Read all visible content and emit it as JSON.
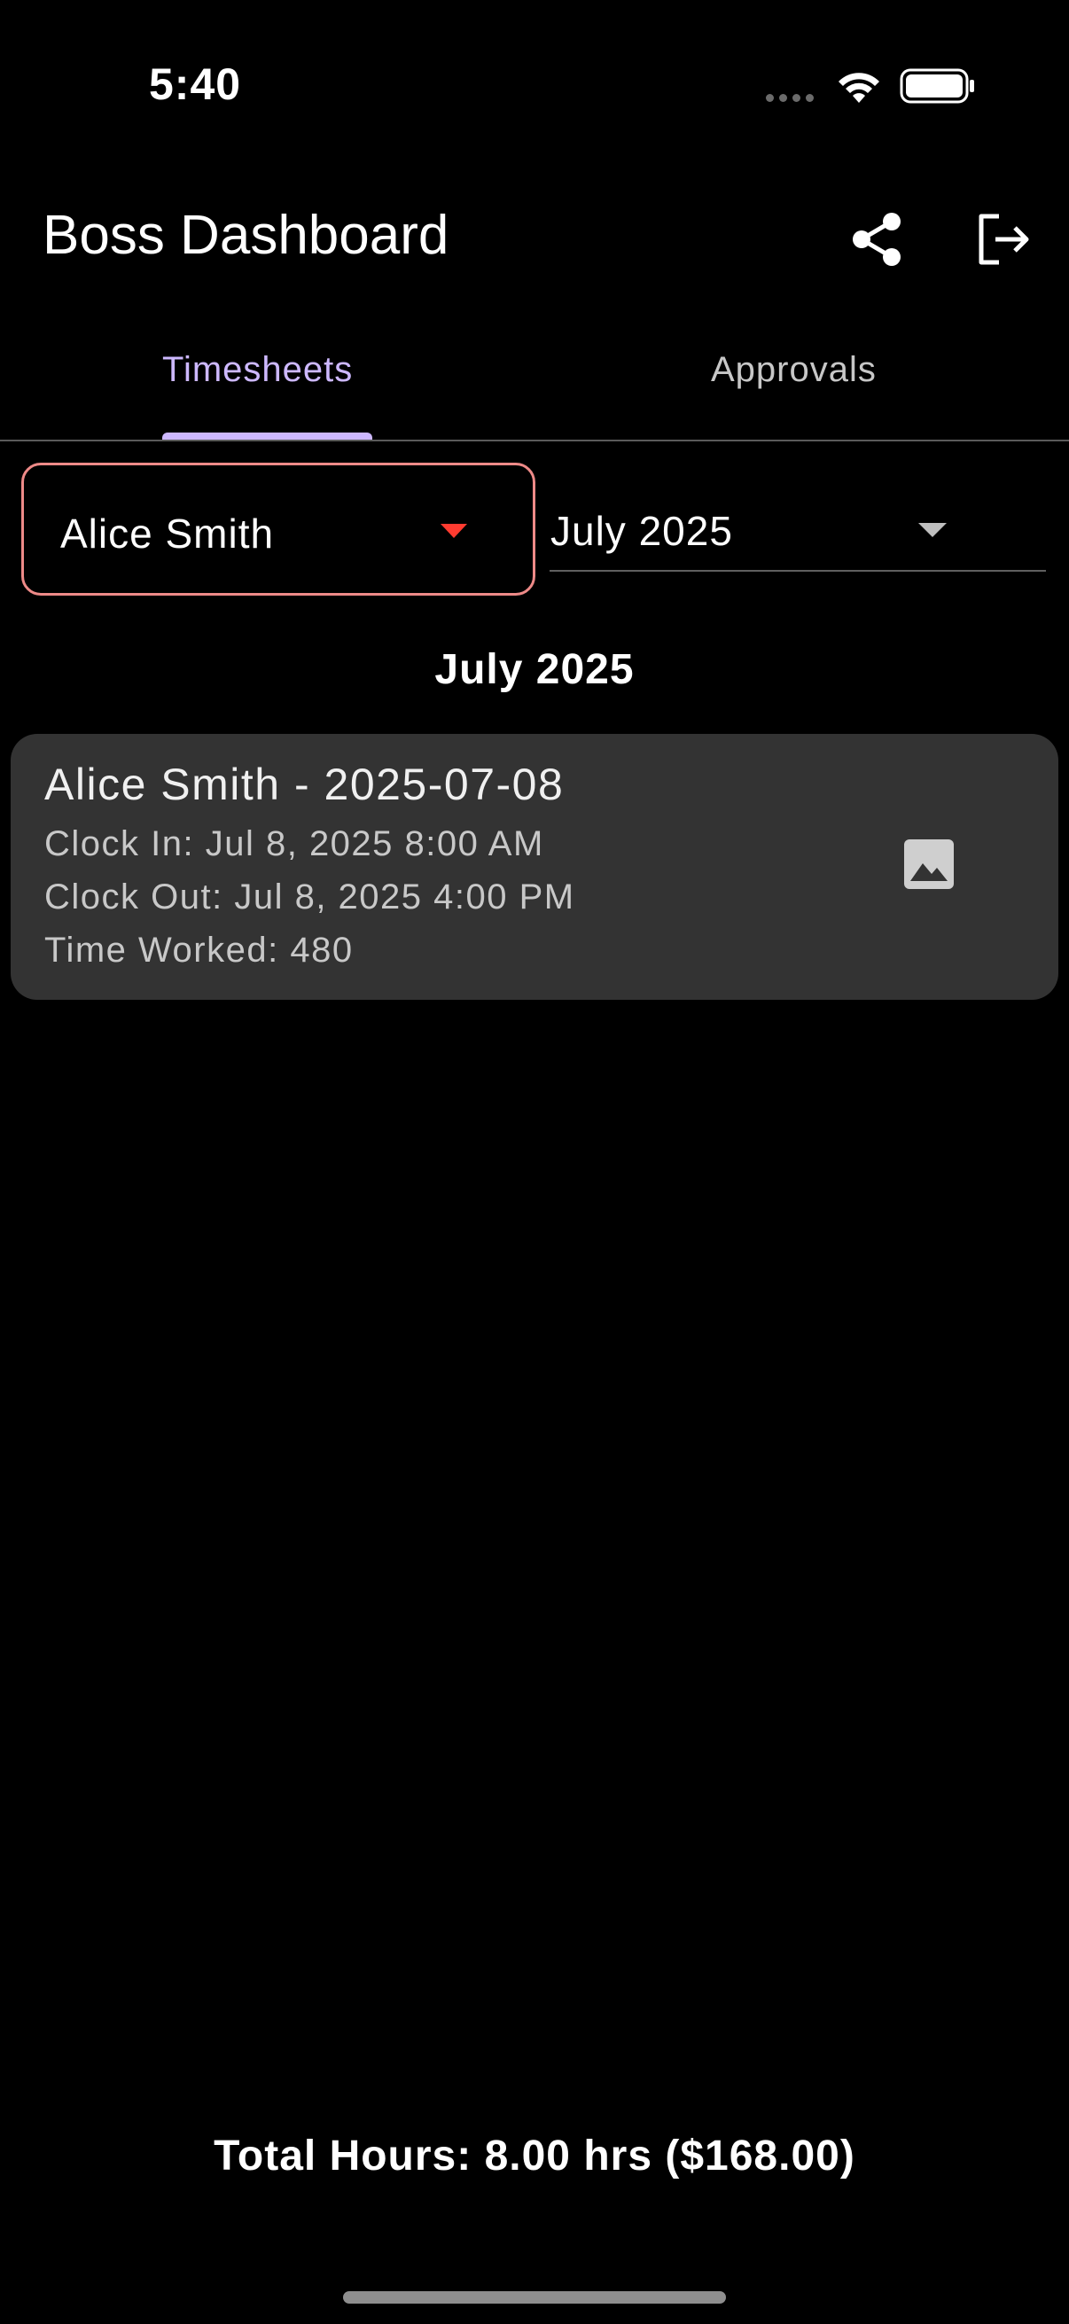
{
  "status_bar": {
    "time": "5:40",
    "icons": [
      "cellular-dots-icon",
      "wifi-icon",
      "battery-icon"
    ]
  },
  "app_bar": {
    "title": "Boss Dashboard",
    "actions": [
      "share-icon",
      "logout-icon"
    ]
  },
  "tabs": [
    {
      "label": "Timesheets",
      "selected": true
    },
    {
      "label": "Approvals",
      "selected": false
    }
  ],
  "filters": {
    "employee": {
      "value": "Alice Smith"
    },
    "month": {
      "value": "July 2025"
    }
  },
  "section_heading": "July 2025",
  "entries": [
    {
      "title": "Alice Smith - 2025-07-08",
      "clock_in": "Clock In: Jul 8, 2025 8:00 AM",
      "clock_out": "Clock Out: Jul 8, 2025 4:00 PM",
      "time_worked": "Time Worked: 480",
      "icon": "image-icon"
    }
  ],
  "footer": {
    "total": "Total Hours: 8.00 hrs ($168.00)"
  },
  "colors": {
    "accent": "#cdb8ff",
    "error_border": "#ee8a88",
    "error_caret": "#ff3b30",
    "card_bg": "#333333",
    "background": "#000000"
  }
}
